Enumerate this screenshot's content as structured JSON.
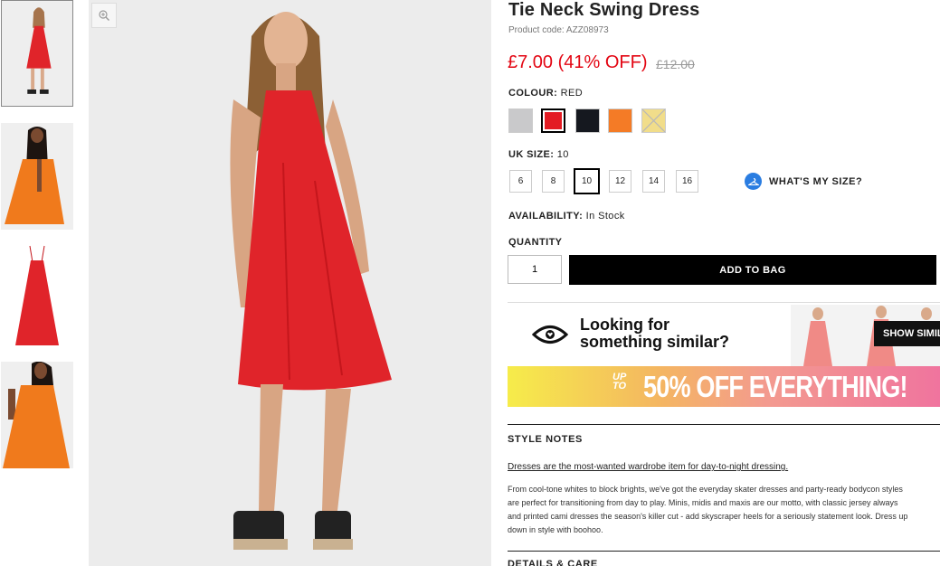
{
  "product": {
    "title": "Tie Neck Swing Dress",
    "product_code": "Product code: AZZ08973",
    "price": "£7.00 (41% OFF)",
    "was_price": "£12.00"
  },
  "colour": {
    "label": "COLOUR:",
    "value": "RED",
    "swatches": [
      {
        "name": "grey",
        "color": "#c9c9cb"
      },
      {
        "name": "red",
        "color": "#e31b23"
      },
      {
        "name": "black",
        "color": "#15181f"
      },
      {
        "name": "orange",
        "color": "#f47b26"
      },
      {
        "name": "yellow",
        "color": "#f1dd8a"
      }
    ],
    "selected": "red"
  },
  "size": {
    "label": "UK SIZE:",
    "value": "10",
    "options": [
      "6",
      "8",
      "10",
      "12",
      "14",
      "16"
    ],
    "whats_my_size": "WHAT'S MY SIZE?"
  },
  "availability": {
    "label": "AVAILABILITY:",
    "value": "In Stock"
  },
  "quantity": {
    "label": "QUANTITY",
    "value": "1"
  },
  "add_to_bag": "ADD TO BAG",
  "similar": {
    "line1": "Looking for",
    "line2": "something similar?",
    "button": "SHOW SIMILAR"
  },
  "banner": {
    "up": "UP",
    "to": "TO",
    "text": "50% OFF EVERYTHING!"
  },
  "style_notes": {
    "heading": "STYLE NOTES",
    "subheading": "Dresses are the most-wanted wardrobe item for day-to-night dressing.",
    "body": [
      "From cool-tone whites to block brights, we've got the everyday skater dresses and party-ready bodycon styles",
      "are perfect for transitioning from day to play. Minis, midis and maxis are our motto, with classic jersey always",
      "and printed cami dresses the season's killer cut - add skyscraper heels for a seriously statement look. Dress up",
      "down in style with boohoo."
    ]
  },
  "details_heading": "DETAILS & CARE",
  "colors": {
    "price_red": "#e30613",
    "dress_red": "#e0242a",
    "dress_orange": "#f07a1c",
    "accent_blue": "#2a7de1"
  }
}
